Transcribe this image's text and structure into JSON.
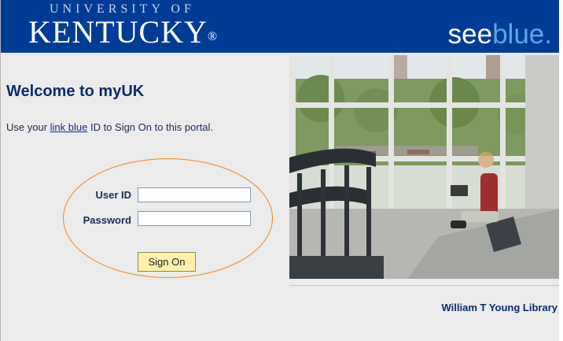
{
  "header": {
    "university_of": "UNIVERSITY OF",
    "kentucky": "KENTUCKY",
    "trademark": "®",
    "see": "see",
    "blue": "blue."
  },
  "login": {
    "welcome": "Welcome to myUK",
    "intro_prefix": "Use your ",
    "intro_link": "link blue",
    "intro_suffix": " ID to Sign On to this portal.",
    "user_id_label": "User ID",
    "password_label": "Password",
    "user_id_value": "",
    "password_value": "",
    "sign_on_label": "Sign On"
  },
  "photo": {
    "caption": "William T Young Library"
  },
  "colors": {
    "header_bg": "#003c96",
    "oval_outline": "#f08a1a",
    "button_bg": "#fff0a8"
  }
}
